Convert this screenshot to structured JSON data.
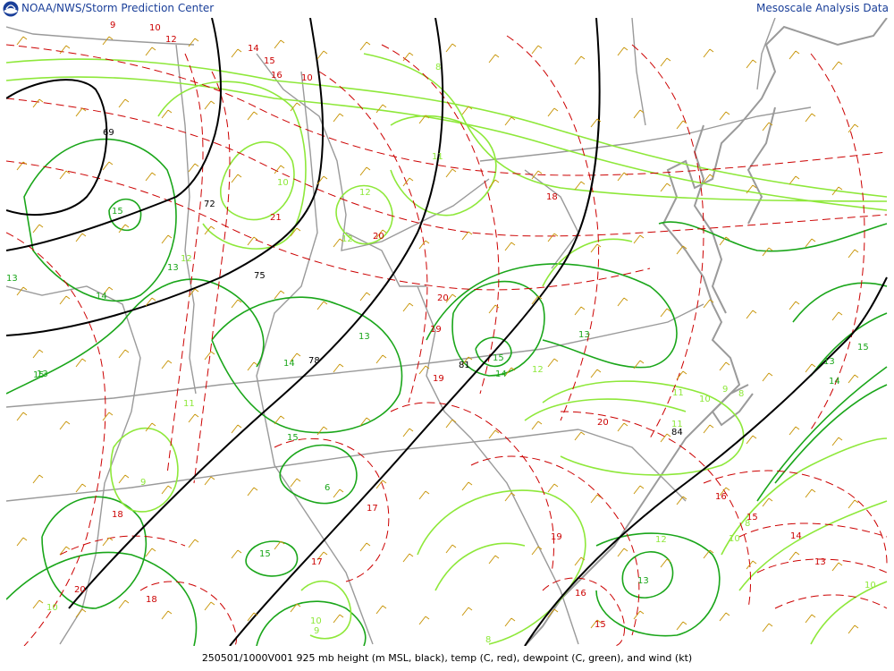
{
  "header": {
    "organization": "NOAA/NWS/Storm Prediction Center",
    "product": "Mesoscale Analysis Data",
    "logo_icon": "noaa-logo-icon"
  },
  "footer": {
    "caption": "250501/1000V001 925 mb height (m MSL, black), temp (C, red), dewpoint (C, green), and wind (kt)"
  },
  "colors": {
    "height": "#000000",
    "temp": "#cc0000",
    "dewpoint_dark": "#1aa61a",
    "dewpoint_light": "#8ee83a",
    "wind": "#c8960a",
    "boundaries": "#9a9a9a",
    "header_text": "#1a3f99"
  },
  "map": {
    "height_labels": [
      "69",
      "72",
      "75",
      "78",
      "81",
      "84"
    ],
    "temp_labels": [
      "9",
      "10",
      "12",
      "14",
      "15",
      "16",
      "10",
      "18",
      "20",
      "21",
      "20",
      "20",
      "19",
      "19",
      "18",
      "20",
      "16",
      "15",
      "14",
      "13",
      "19",
      "17",
      "17",
      "18",
      "16",
      "15"
    ],
    "dewpoint_labels": [
      "15",
      "13",
      "13",
      "14",
      "12",
      "11",
      "10",
      "12",
      "12",
      "13",
      "14",
      "11",
      "9",
      "8",
      "15",
      "15",
      "14",
      "12",
      "13",
      "11",
      "10",
      "9",
      "8",
      "6",
      "15",
      "15",
      "13",
      "12",
      "13",
      "14",
      "15",
      "13",
      "10",
      "8",
      "10",
      "11",
      "10",
      "9",
      "8",
      "10"
    ]
  }
}
